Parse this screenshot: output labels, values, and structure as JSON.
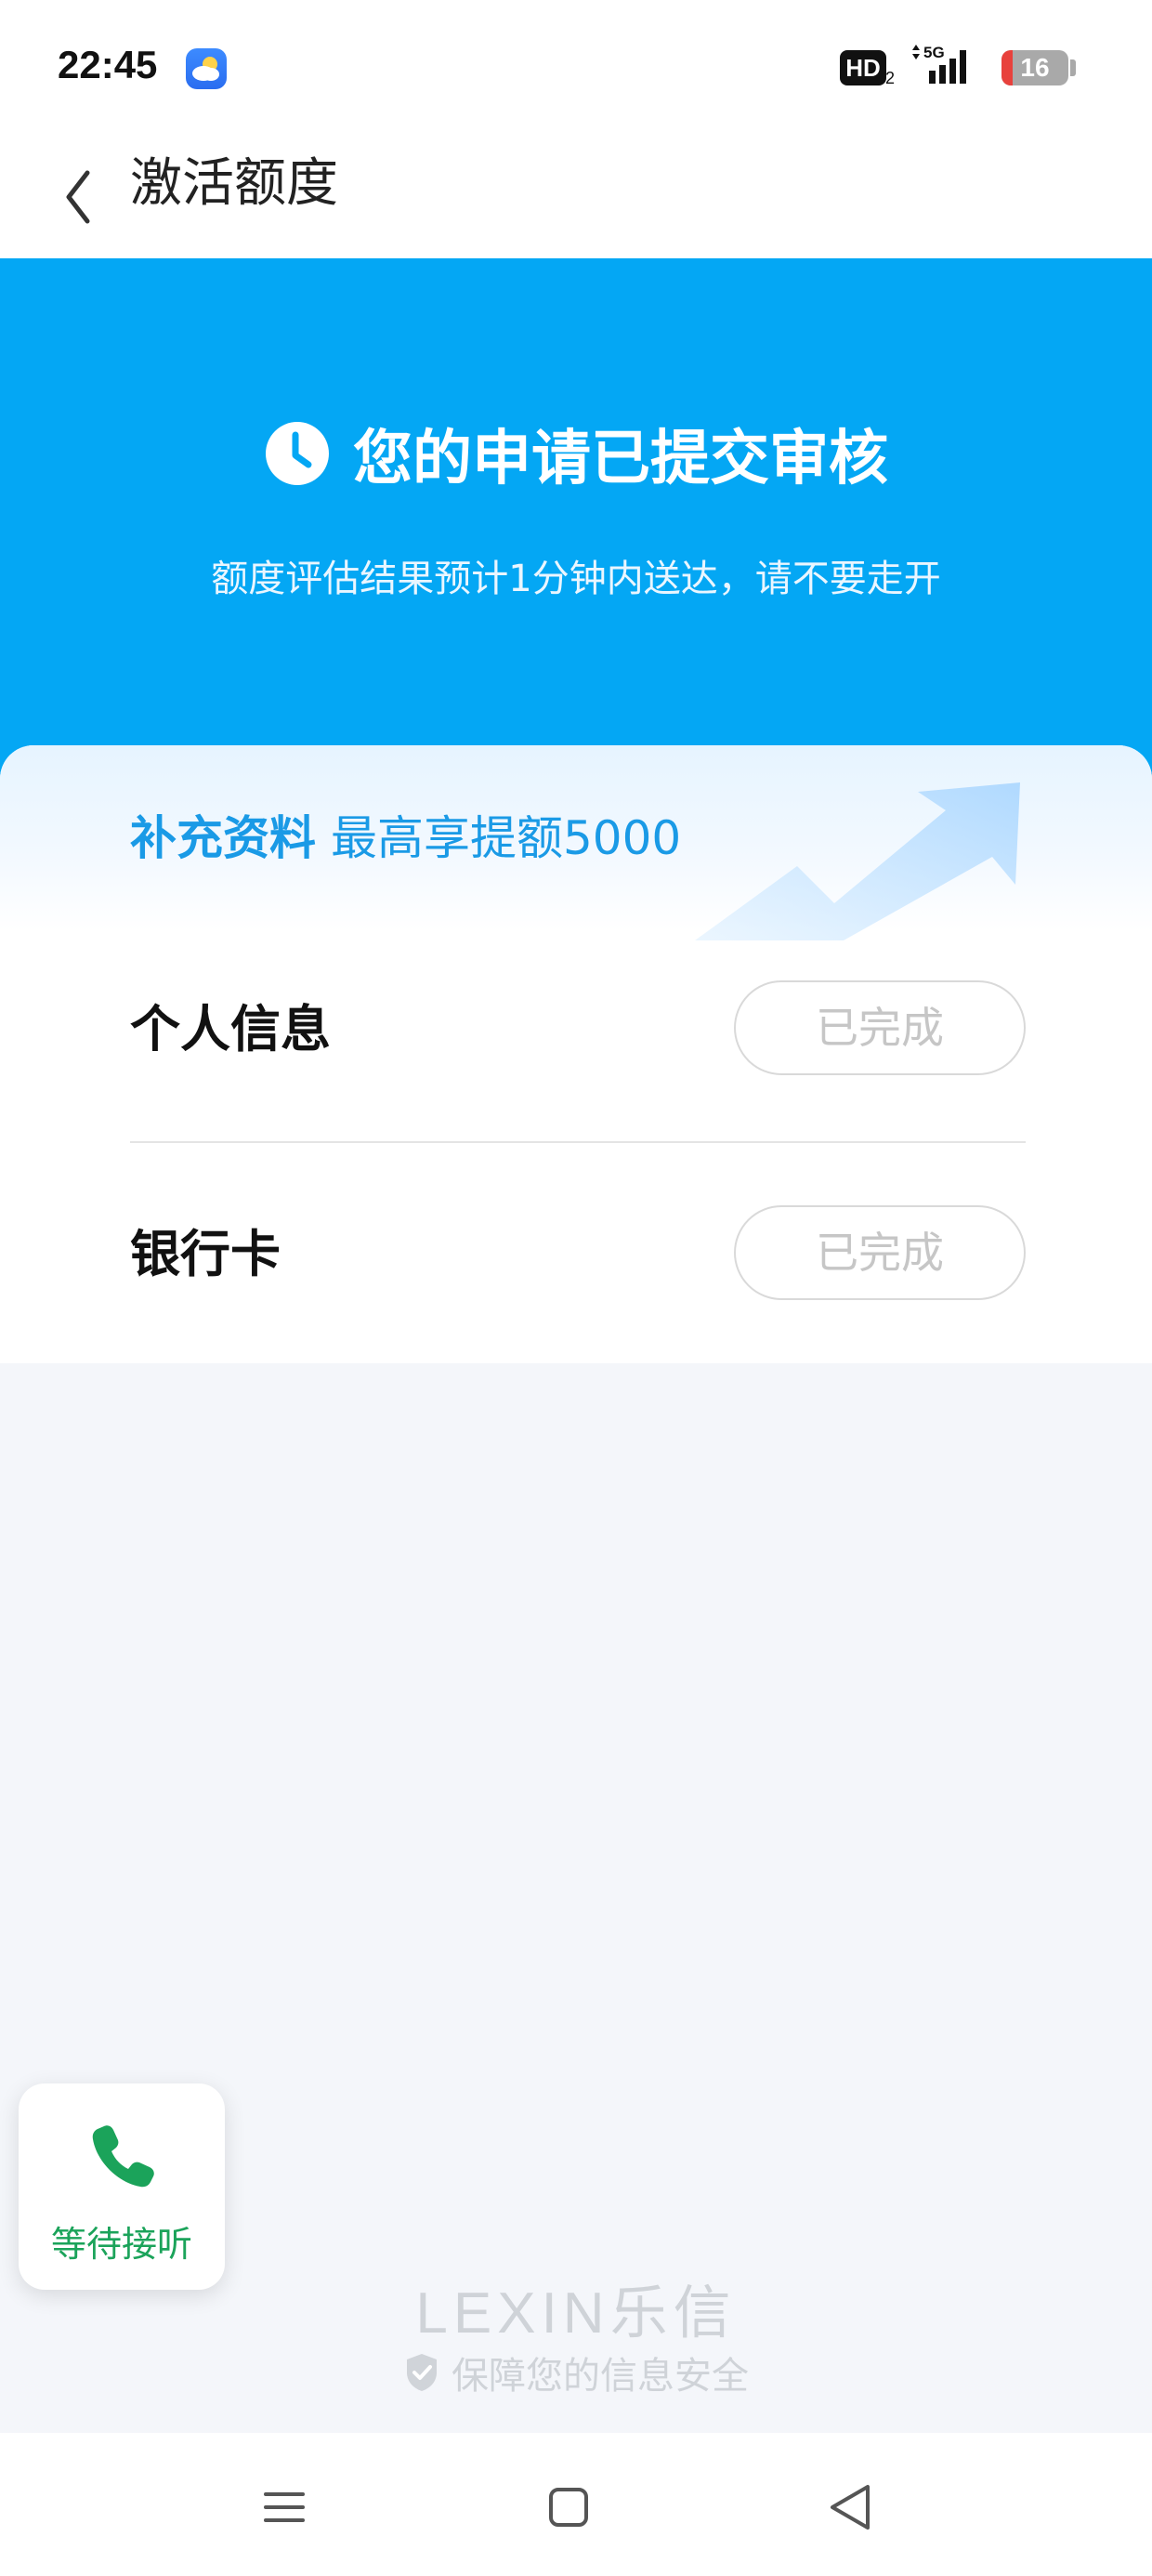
{
  "status_bar": {
    "time": "22:45",
    "weather_icon": "weather-partly-cloudy-icon",
    "hd_label": "HD",
    "hd_sub": "2",
    "network": "5G",
    "battery_level": "16",
    "battery_low_color": "#e8413c"
  },
  "header": {
    "back_icon": "chevron-left-icon",
    "title": "激活额度"
  },
  "hero": {
    "background": "#04a7f4",
    "icon": "clock-icon",
    "title": "您的申请已提交审核",
    "subtitle": "额度评估结果预计1分钟内送达，请不要走开"
  },
  "promo": {
    "tag": "补充资料",
    "text": "最高享提额5000",
    "accent": "#1a9ae6"
  },
  "items": [
    {
      "label": "个人信息",
      "status": "已完成"
    },
    {
      "label": "银行卡",
      "status": "已完成"
    }
  ],
  "call_widget": {
    "icon": "phone-icon",
    "label": "等待接听",
    "color": "#1ba35a"
  },
  "footer": {
    "brand": "LEXIN乐信",
    "security_icon": "shield-check-icon",
    "security_text": "保障您的信息安全"
  },
  "nav_bar": {
    "buttons": [
      "menu-icon",
      "home-square-icon",
      "back-triangle-icon"
    ]
  }
}
